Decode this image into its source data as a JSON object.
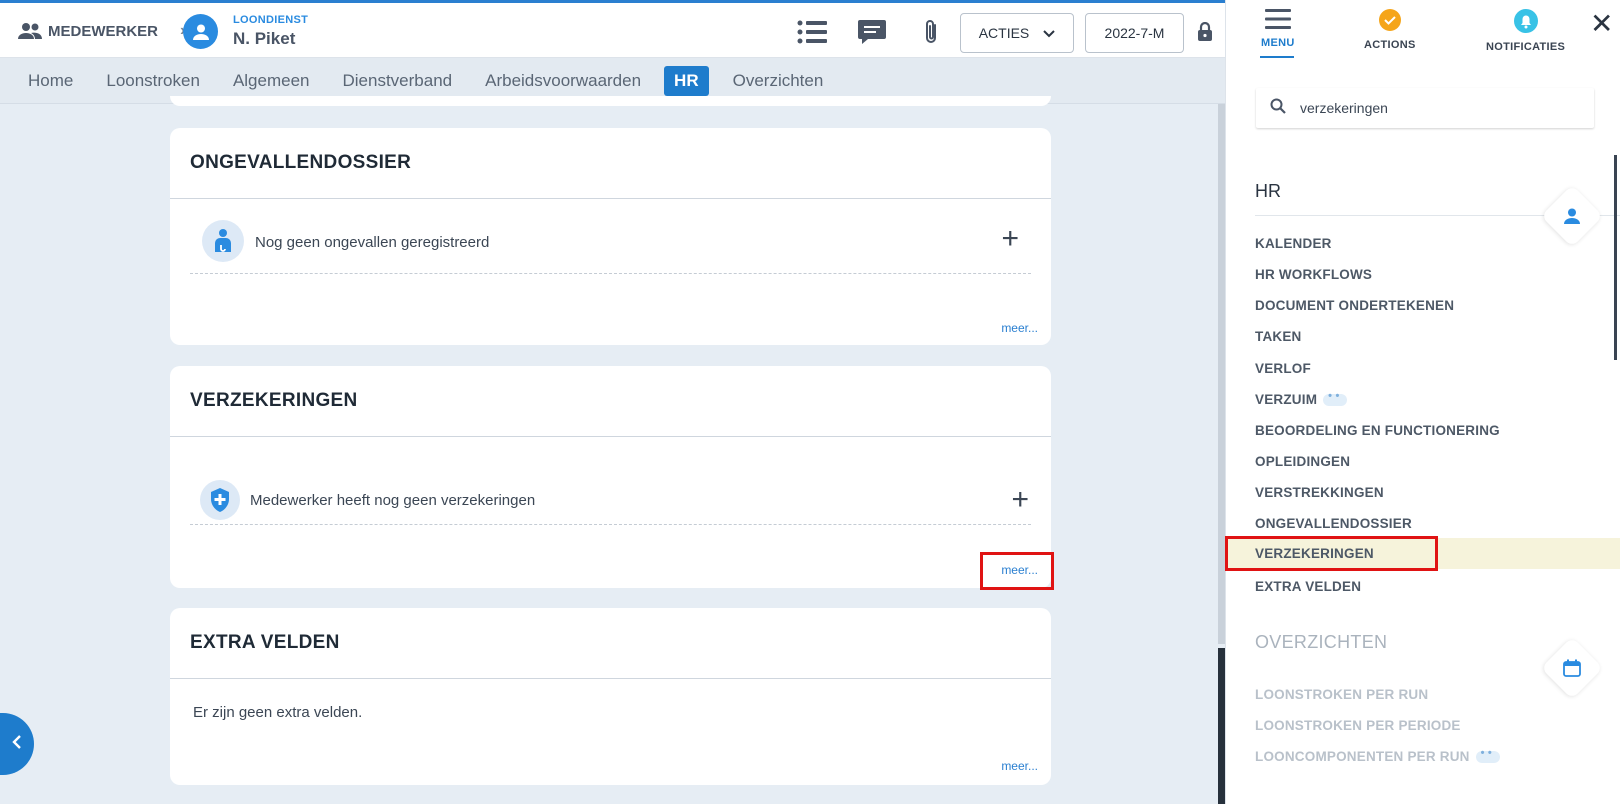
{
  "header": {
    "breadcrumb_root": "MEDEWERKER",
    "employee_type": "LOONDIENST",
    "employee_name": "N. Piket",
    "acties_label": "ACTIES",
    "period": "2022-7-M"
  },
  "tabs": [
    "Home",
    "Loonstroken",
    "Algemeen",
    "Dienstverband",
    "Arbeidsvoorwaarden",
    "HR",
    "Overzichten"
  ],
  "active_tab": "HR",
  "cards": {
    "ongevallen": {
      "title": "ONGEVALLENDOSSIER",
      "empty_text": "Nog geen ongevallen geregistreerd",
      "more": "meer..."
    },
    "verzekeringen": {
      "title": "VERZEKERINGEN",
      "empty_text": "Medewerker heeft nog geen verzekeringen",
      "more": "meer..."
    },
    "extra": {
      "title": "EXTRA VELDEN",
      "empty_text": "Er zijn geen extra velden.",
      "more": "meer..."
    }
  },
  "panel": {
    "tabs": {
      "menu": "MENU",
      "actions": "ACTIONS",
      "notifications": "NOTIFICATIES"
    },
    "search_value": "verzekeringen",
    "hr_section": "HR",
    "hr_items": [
      "KALENDER",
      "HR WORKFLOWS",
      "DOCUMENT ONDERTEKENEN",
      "TAKEN",
      "VERLOF",
      "VERZUIM",
      "BEOORDELING EN FUNCTIONERING",
      "OPLEIDINGEN",
      "VERSTREKKINGEN",
      "ONGEVALLENDOSSIER",
      "VERZEKERINGEN",
      "EXTRA VELDEN"
    ],
    "highlighted_item": "VERZEKERINGEN",
    "overzichten_section": "OVERZICHTEN",
    "overzichten_items": [
      "LOONSTROKEN PER RUN",
      "LOONSTROKEN PER PERIODE",
      "LOONCOMPONENTEN PER RUN"
    ]
  },
  "colors": {
    "accent": "#1e7ccc",
    "highlight": "#f6f3db",
    "annotation": "#e01313"
  }
}
